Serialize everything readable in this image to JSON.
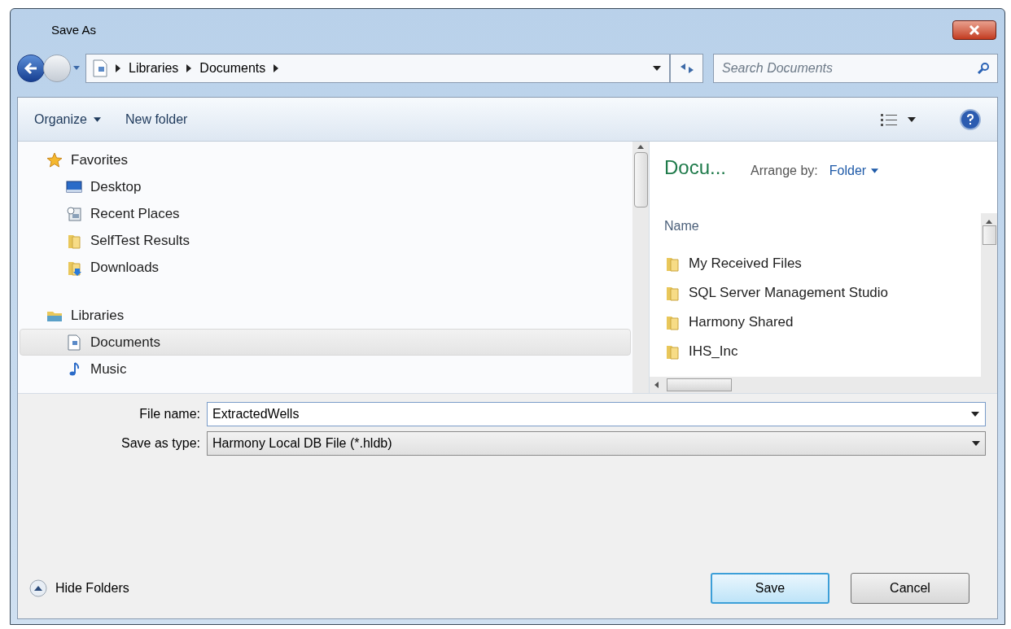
{
  "window": {
    "title": "Save As"
  },
  "address": {
    "segments": [
      "Libraries",
      "Documents"
    ]
  },
  "search": {
    "placeholder": "Search Documents"
  },
  "toolbar": {
    "organize": "Organize",
    "new_folder": "New folder"
  },
  "nav": [
    {
      "kind": "header",
      "label": "Favorites",
      "selected": false
    },
    {
      "kind": "item",
      "label": "Desktop",
      "selected": false
    },
    {
      "kind": "item",
      "label": "Recent Places",
      "selected": false
    },
    {
      "kind": "item",
      "label": "SelfTest Results",
      "selected": false
    },
    {
      "kind": "item",
      "label": "Downloads",
      "selected": false
    },
    {
      "kind": "gap"
    },
    {
      "kind": "header",
      "label": "Libraries",
      "selected": false
    },
    {
      "kind": "item",
      "label": "Documents",
      "selected": true
    },
    {
      "kind": "item",
      "label": "Music",
      "selected": false
    }
  ],
  "content": {
    "title": "Docu...",
    "arrange_label": "Arrange by:",
    "arrange_value": "Folder",
    "column": "Name",
    "files": [
      "My Received Files",
      "SQL Server Management Studio",
      "Harmony Shared",
      "IHS_Inc"
    ]
  },
  "file_name": {
    "label": "File name:",
    "value": "ExtractedWells"
  },
  "save_type": {
    "label": "Save as type:",
    "value": "Harmony Local DB File (*.hldb)"
  },
  "hide_folders": "Hide Folders",
  "buttons": [
    {
      "label": "Save",
      "default": true
    },
    {
      "label": "Cancel",
      "default": false
    }
  ]
}
